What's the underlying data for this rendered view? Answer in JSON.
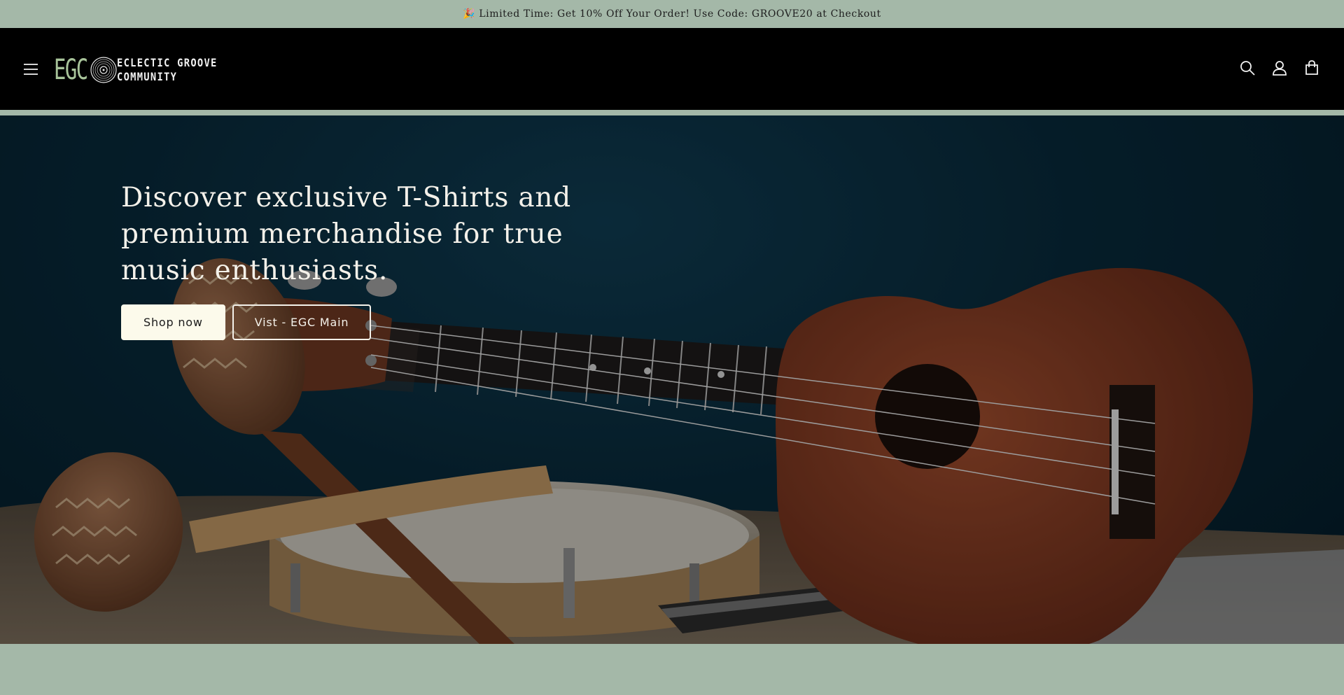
{
  "announcement": {
    "icon": "party-popper-icon",
    "party_glyph": "🎉",
    "text": "Limited Time: Get 10% Off Your Order! Use Code: GROOVE20 at Checkout"
  },
  "header": {
    "logo": {
      "mark": "EGC",
      "line1": "ECLECTIC GROOVE",
      "line2": "COMMUNITY"
    },
    "icons": [
      "menu-icon",
      "search-icon",
      "account-icon",
      "cart-icon"
    ]
  },
  "hero": {
    "heading": "Discover exclusive T-Shirts and premium merchandise for true music enthusiasts.",
    "primary_button": "Shop now",
    "secondary_button": "Vist - EGC Main"
  },
  "colors": {
    "announcement_bg": "#a4b8a8",
    "header_bg": "#000000",
    "logo_accent": "#a8c49a",
    "hero_bg": "#082838",
    "primary_button_bg": "#fcfaeb"
  }
}
